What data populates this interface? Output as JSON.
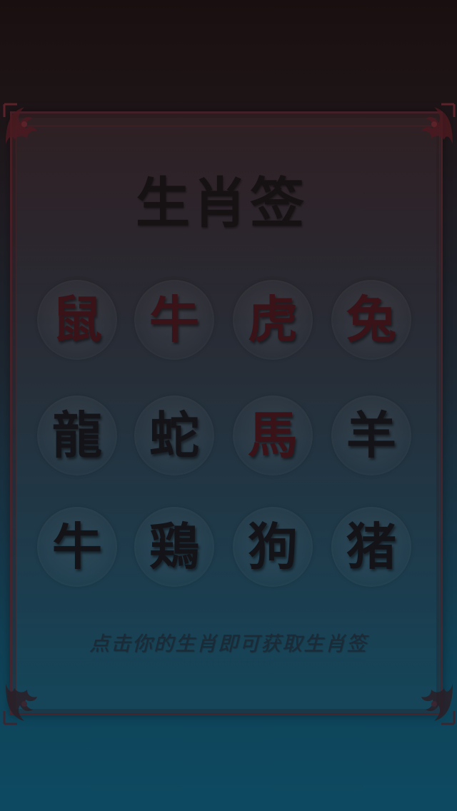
{
  "page": {
    "title": "生肖签",
    "hint": "点击你的生肖即可获取生肖签"
  },
  "colors": {
    "background_top": "#1a0f10",
    "background_bottom": "#0d4a62",
    "frame_border": "#501e24",
    "char_red": "#3a1318",
    "char_dark": "#141318"
  },
  "zodiac": [
    {
      "label": "鼠",
      "tone": "red"
    },
    {
      "label": "牛",
      "tone": "red"
    },
    {
      "label": "虎",
      "tone": "red"
    },
    {
      "label": "兔",
      "tone": "red"
    },
    {
      "label": "龍",
      "tone": "dark"
    },
    {
      "label": "蛇",
      "tone": "dark"
    },
    {
      "label": "馬",
      "tone": "red"
    },
    {
      "label": "羊",
      "tone": "dark"
    },
    {
      "label": "牛",
      "tone": "dark"
    },
    {
      "label": "鶏",
      "tone": "dark"
    },
    {
      "label": "狗",
      "tone": "dark"
    },
    {
      "label": "猪",
      "tone": "dark"
    }
  ]
}
